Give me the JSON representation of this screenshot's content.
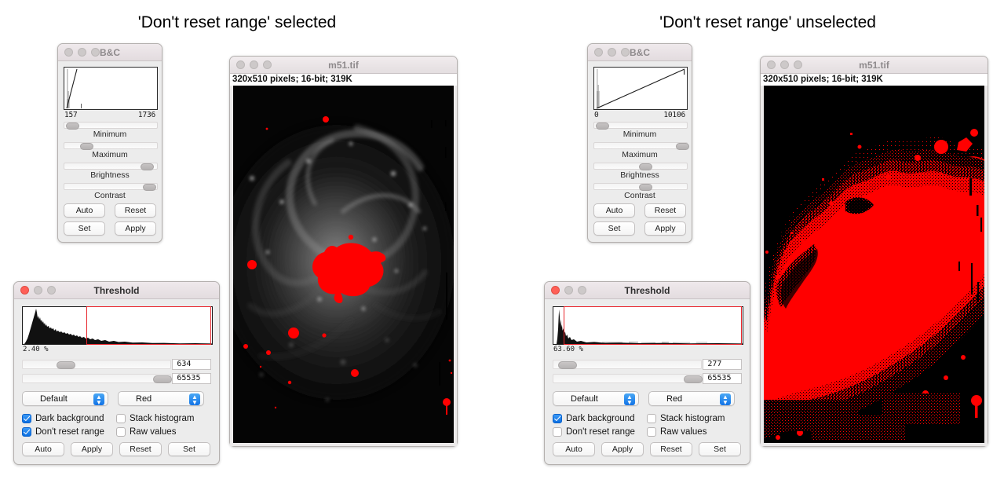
{
  "panels": {
    "left": {
      "heading": "'Don't reset range' selected"
    },
    "right": {
      "heading": "'Don't reset range' unselected"
    }
  },
  "bc_left": {
    "window_title": "B&C",
    "hist_min_label": "157",
    "hist_max_label": "1736",
    "sliders": [
      {
        "label": "Minimum",
        "position_pct": 2
      },
      {
        "label": "Maximum",
        "position_pct": 17
      },
      {
        "label": "Brightness",
        "position_pct": 82
      },
      {
        "label": "Contrast",
        "position_pct": 85
      }
    ],
    "buttons": [
      "Auto",
      "Reset",
      "Set",
      "Apply"
    ],
    "traffic_lights": [
      "inactive",
      "inactive",
      "inactive"
    ]
  },
  "bc_right": {
    "window_title": "B&C",
    "hist_min_label": "0",
    "hist_max_label": "10106",
    "sliders": [
      {
        "label": "Minimum",
        "position_pct": 2
      },
      {
        "label": "Maximum",
        "position_pct": 88
      },
      {
        "label": "Brightness",
        "position_pct": 48
      },
      {
        "label": "Contrast",
        "position_pct": 48
      }
    ],
    "buttons": [
      "Auto",
      "Reset",
      "Set",
      "Apply"
    ],
    "traffic_lights": [
      "inactive",
      "inactive",
      "inactive"
    ]
  },
  "threshold_left": {
    "window_title": "Threshold",
    "percent_label": "2.40 %",
    "selection_start_pct": 34,
    "selection_end_pct": 100,
    "lower_value": "634",
    "upper_value": "65535",
    "lower_slider_pct": 23,
    "upper_slider_pct": 88,
    "method_select": "Default",
    "lut_select": "Red",
    "checkboxes": [
      {
        "label": "Dark background",
        "checked": true
      },
      {
        "label": "Stack histogram",
        "checked": false
      },
      {
        "label": "Don't reset range",
        "checked": true
      },
      {
        "label": "Raw values",
        "checked": false
      }
    ],
    "buttons": [
      "Auto",
      "Apply",
      "Reset",
      "Set"
    ],
    "traffic_lights": [
      "close",
      "inactive",
      "inactive"
    ]
  },
  "threshold_right": {
    "window_title": "Threshold",
    "percent_label": "63.60 %",
    "selection_start_pct": 6,
    "selection_end_pct": 100,
    "lower_value": "277",
    "upper_value": "65535",
    "lower_slider_pct": 3,
    "upper_slider_pct": 88,
    "method_select": "Default",
    "lut_select": "Red",
    "checkboxes": [
      {
        "label": "Dark background",
        "checked": true
      },
      {
        "label": "Stack histogram",
        "checked": false
      },
      {
        "label": "Don't reset range",
        "checked": false
      },
      {
        "label": "Raw values",
        "checked": false
      }
    ],
    "buttons": [
      "Auto",
      "Apply",
      "Reset",
      "Set"
    ],
    "traffic_lights": [
      "close",
      "inactive",
      "inactive"
    ]
  },
  "image_left": {
    "window_title": "m51.tif",
    "info": "320x510 pixels; 16-bit; 319K",
    "traffic_lights": [
      "inactive",
      "inactive",
      "inactive"
    ]
  },
  "image_right": {
    "window_title": "m51.tif",
    "info": "320x510 pixels; 16-bit; 319K",
    "traffic_lights": [
      "inactive",
      "inactive",
      "inactive"
    ]
  },
  "colors": {
    "threshold_overlay": "#ff0000",
    "selection_box": "#e8242a",
    "checkbox_on": "#0a6ee0",
    "traffic_close": "#ff5f57",
    "window_bg": "#ececec"
  }
}
